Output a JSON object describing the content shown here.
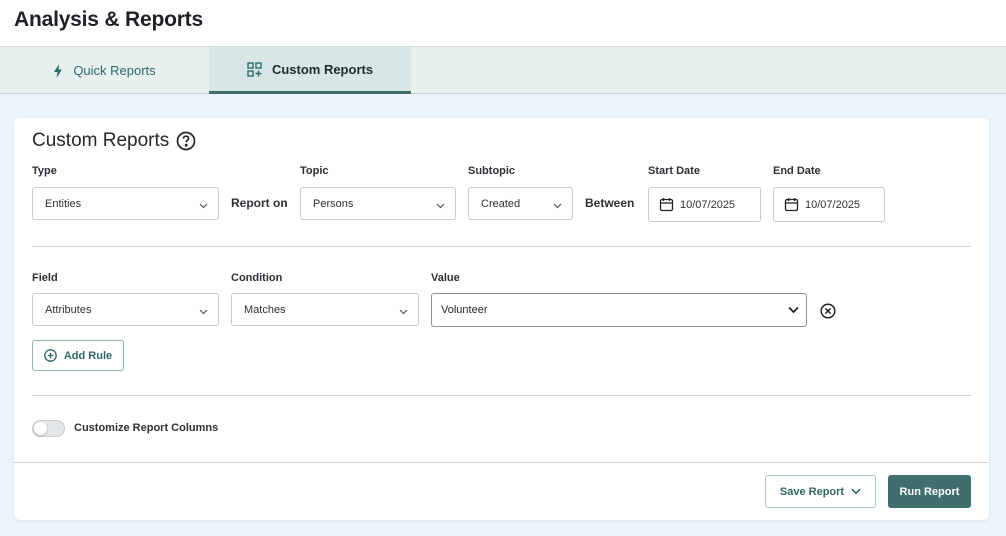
{
  "page": {
    "title": "Analysis & Reports"
  },
  "tabs": [
    {
      "label": "Quick Reports",
      "icon": "lightning-icon",
      "active": false
    },
    {
      "label": "Custom Reports",
      "icon": "grid-plus-icon",
      "active": true
    }
  ],
  "card": {
    "title": "Custom Reports",
    "help_icon": "question-circle-icon",
    "type": {
      "label": "Type",
      "value": "Entities"
    },
    "report_on_label": "Report on",
    "topic": {
      "label": "Topic",
      "value": "Persons"
    },
    "subtopic": {
      "label": "Subtopic",
      "value": "Created"
    },
    "between_label": "Between",
    "start_date": {
      "label": "Start Date",
      "value": "10/07/2025"
    },
    "end_date": {
      "label": "End Date",
      "value": "10/07/2025"
    }
  },
  "rule": {
    "field": {
      "label": "Field",
      "value": "Attributes"
    },
    "condition": {
      "label": "Condition",
      "value": "Matches"
    },
    "value": {
      "label": "Value",
      "value": "Volunteer"
    },
    "remove_icon": "close-circle-icon"
  },
  "add_rule_label": "Add Rule",
  "customize": {
    "label": "Customize Report Columns",
    "on": false
  },
  "footer": {
    "save_label": "Save Report",
    "run_label": "Run Report"
  },
  "colors": {
    "accent": "#3f6e6d",
    "tab_active_bg": "#d6e7e6",
    "content_bg": "#eaf5fb"
  }
}
